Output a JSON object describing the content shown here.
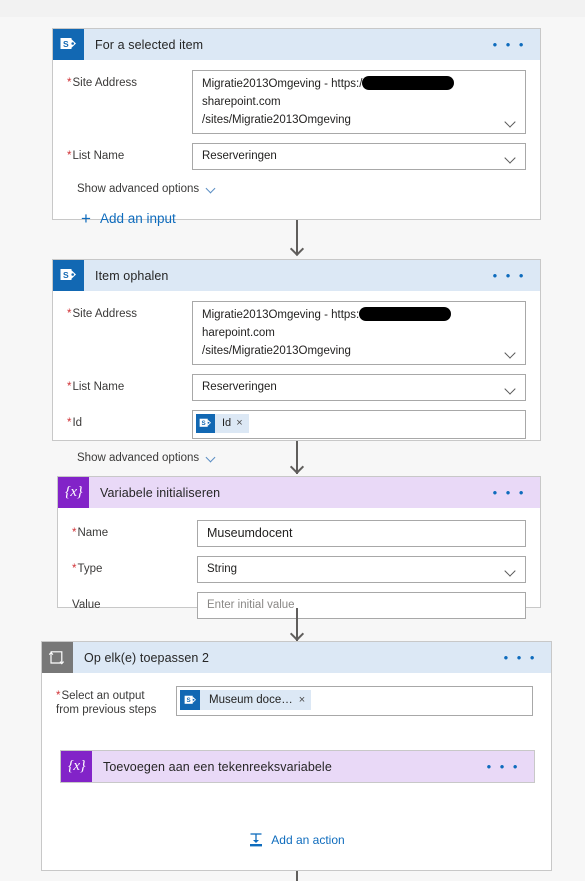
{
  "app": {
    "background": "#f7f7f7",
    "accent": "#0f6cbd",
    "required_marker_color": "#d13438",
    "sharepoint_brand": "#1268b3",
    "variable_brand": "#8223c8",
    "loop_brand": "#787878"
  },
  "cards": [
    {
      "id": "for-a-selected-item",
      "title": "For a selected item",
      "icon": "sharepoint-icon",
      "type": "sharepoint",
      "menu": "• • •",
      "fields": [
        {
          "label": "Site Address",
          "required": true,
          "value_line1": "Migratie2013Omgeving - https:/",
          "value_redacted": true,
          "value_line1_tail": "sharepoint.com",
          "value_line2": "/sites/Migratie2013Omgeving",
          "control": "dropdown"
        },
        {
          "label": "List Name",
          "required": true,
          "value": "Reserveringen",
          "control": "dropdown"
        }
      ],
      "advanced_label": "Show advanced options",
      "add_input_label": "Add an input"
    },
    {
      "id": "item-ophalen",
      "title": "Item ophalen",
      "icon": "sharepoint-icon",
      "type": "sharepoint",
      "menu": "• • •",
      "fields": [
        {
          "label": "Site Address",
          "required": true,
          "value_line1": "Migratie2013Omgeving - https:",
          "value_redacted": true,
          "value_line1_tail": "harepoint.com",
          "value_line2": "/sites/Migratie2013Omgeving",
          "control": "dropdown"
        },
        {
          "label": "List Name",
          "required": true,
          "value": "Reserveringen",
          "control": "dropdown"
        },
        {
          "label": "Id",
          "required": true,
          "token": {
            "icon": "sharepoint-icon",
            "text": "Id",
            "remove": "×"
          },
          "control": "token"
        }
      ],
      "advanced_label": "Show advanced options"
    },
    {
      "id": "variabele-initialiseren",
      "title": "Variabele initialiseren",
      "icon": "variable-icon",
      "type": "variable",
      "menu": "• • •",
      "fields": [
        {
          "label": "Name",
          "required": true,
          "value": "Museumdocent",
          "control": "text"
        },
        {
          "label": "Type",
          "required": true,
          "value": "String",
          "control": "dropdown"
        },
        {
          "label": "Value",
          "required": false,
          "placeholder": "Enter initial value",
          "control": "text"
        }
      ]
    },
    {
      "id": "op-elke-toepassen-2",
      "title": "Op elk(e) toepassen 2",
      "icon": "loop-icon",
      "type": "loop",
      "menu": "• • •",
      "fields": [
        {
          "label_line1": "Select an output",
          "label_line2": "from previous steps",
          "required": true,
          "token": {
            "icon": "sharepoint-icon",
            "text": "Museum doce…",
            "remove": "×"
          },
          "control": "token"
        }
      ],
      "nested_card": {
        "id": "toevoegen-aan-een-tekenreeksvariabele",
        "title": "Toevoegen aan een tekenreeksvariabele",
        "icon": "variable-icon",
        "type": "variable",
        "menu": "• • •"
      },
      "add_action_label": "Add an action"
    }
  ]
}
